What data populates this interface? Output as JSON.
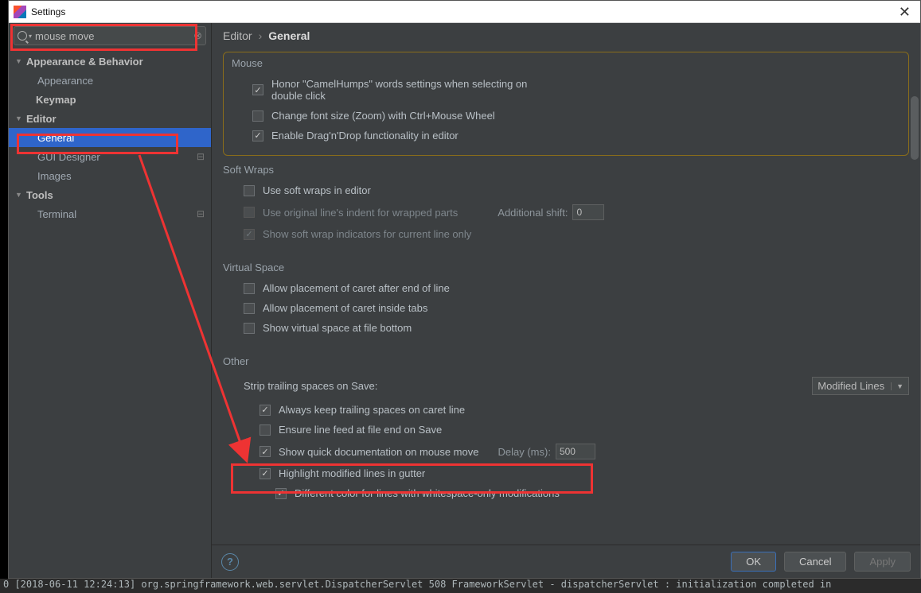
{
  "window": {
    "title": "Settings"
  },
  "search": {
    "value": "mouse move"
  },
  "sidebar": {
    "items": [
      {
        "label": "Appearance & Behavior",
        "expandable": true,
        "bold": true,
        "level": 0
      },
      {
        "label": "Appearance",
        "level": 2
      },
      {
        "label": "Keymap",
        "bold": true,
        "level": 1
      },
      {
        "label": "Editor",
        "expandable": true,
        "bold": true,
        "level": 0
      },
      {
        "label": "General",
        "level": 2,
        "selected": true
      },
      {
        "label": "GUI Designer",
        "level": 2,
        "gear": true
      },
      {
        "label": "Images",
        "level": 2
      },
      {
        "label": "Tools",
        "expandable": true,
        "bold": true,
        "level": 0
      },
      {
        "label": "Terminal",
        "level": 2,
        "gear": true
      }
    ]
  },
  "breadcrumb": {
    "a": "Editor",
    "b": "General"
  },
  "sections": {
    "mouse": {
      "title": "Mouse",
      "opt1": "Honor \"CamelHumps\" words settings when selecting on double click",
      "opt2": "Change font size (Zoom) with Ctrl+Mouse Wheel",
      "opt3": "Enable Drag'n'Drop functionality in editor"
    },
    "softwraps": {
      "title": "Soft Wraps",
      "opt1": "Use soft wraps in editor",
      "opt2": "Use original line's indent for wrapped parts",
      "shift_label": "Additional shift:",
      "shift_value": "0",
      "opt3": "Show soft wrap indicators for current line only"
    },
    "virtual": {
      "title": "Virtual Space",
      "opt1": "Allow placement of caret after end of line",
      "opt2": "Allow placement of caret inside tabs",
      "opt3": "Show virtual space at file bottom"
    },
    "other": {
      "title": "Other",
      "strip_label": "Strip trailing spaces on Save:",
      "strip_value": "Modified Lines",
      "opt1": "Always keep trailing spaces on caret line",
      "opt2": "Ensure line feed at file end on Save",
      "opt3": "Show quick documentation on mouse move",
      "delay_label": "Delay (ms):",
      "delay_value": "500",
      "opt4": "Highlight modified lines in gutter",
      "opt5": "Different color for lines with whitespace-only modifications"
    }
  },
  "buttons": {
    "ok": "OK",
    "cancel": "Cancel",
    "apply": "Apply"
  },
  "console": "0  [2018-06-11 12:24:13] org.springframework.web.servlet.DispatcherServlet 508 FrameworkServlet - dispatcherServlet : initialization completed in"
}
